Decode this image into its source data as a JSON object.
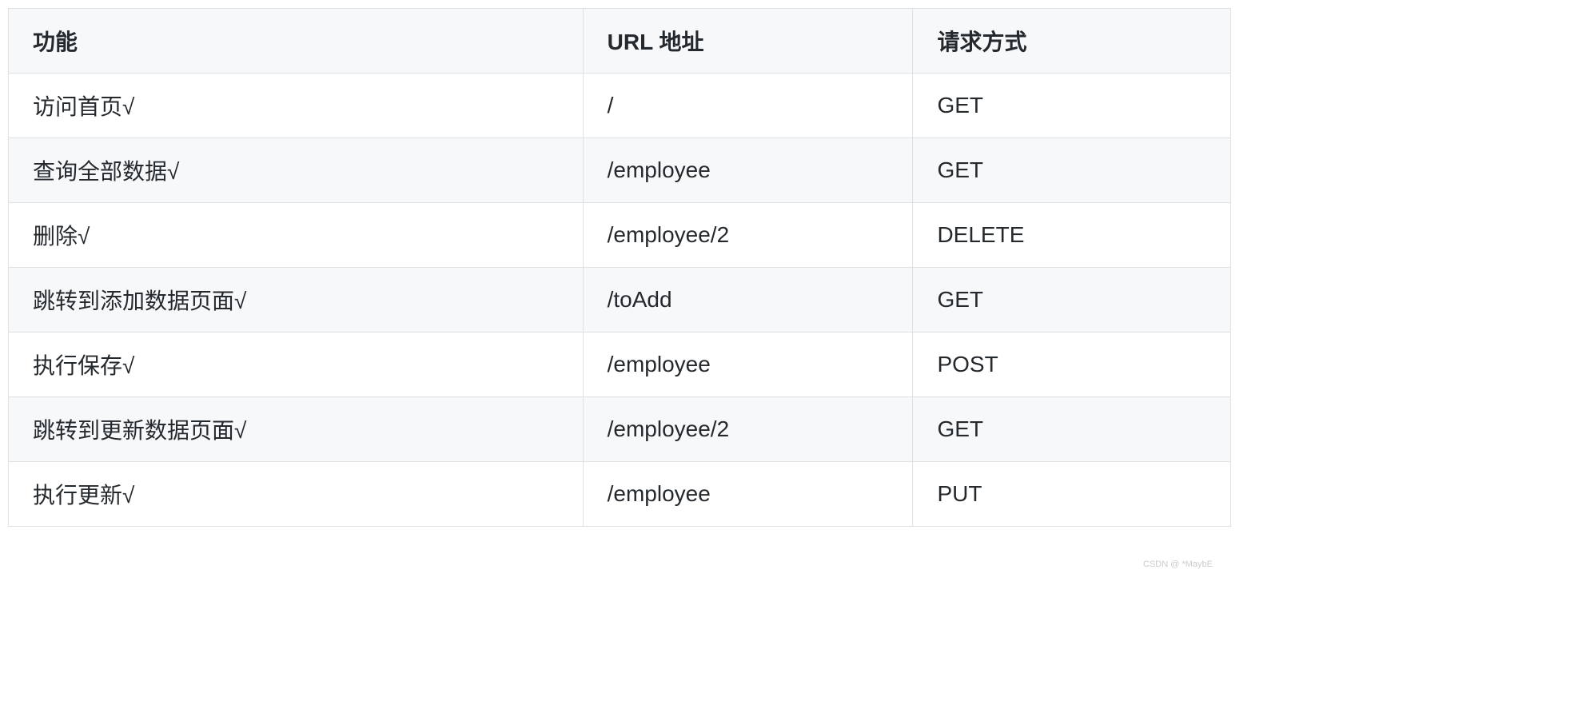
{
  "table": {
    "headers": {
      "function": "功能",
      "url": "URL 地址",
      "method": "请求方式"
    },
    "rows": [
      {
        "function": "访问首页√",
        "url": "/",
        "method": "GET"
      },
      {
        "function": "查询全部数据√",
        "url": "/employee",
        "method": "GET"
      },
      {
        "function": "删除√",
        "url": "/employee/2",
        "method": "DELETE"
      },
      {
        "function": "跳转到添加数据页面√",
        "url": "/toAdd",
        "method": "GET"
      },
      {
        "function": "执行保存√",
        "url": "/employee",
        "method": "POST"
      },
      {
        "function": "跳转到更新数据页面√",
        "url": "/employee/2",
        "method": "GET"
      },
      {
        "function": "执行更新√",
        "url": "/employee",
        "method": "PUT"
      }
    ]
  },
  "watermark": "CSDN @ *MaybE"
}
